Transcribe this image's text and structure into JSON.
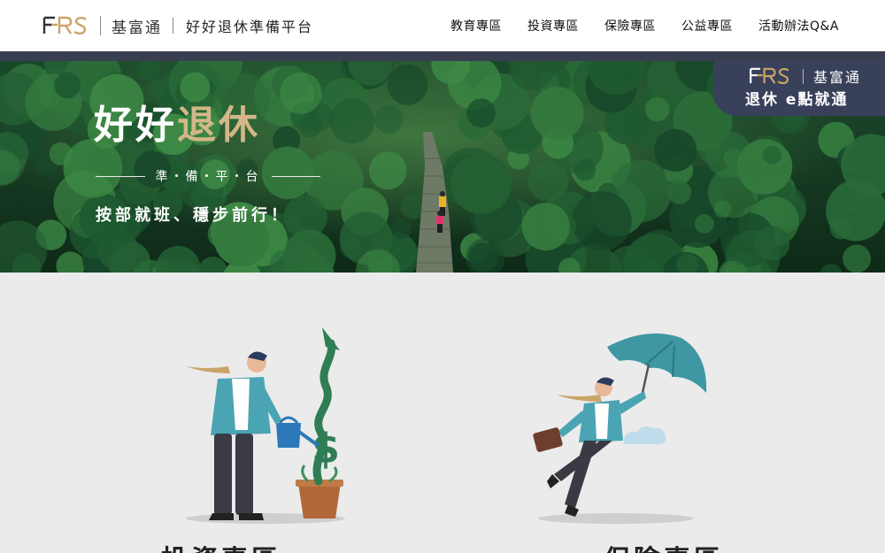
{
  "header": {
    "logo_mark": "FRS",
    "brand_name": "基富通",
    "site_title": "好好退休準備平台",
    "nav": [
      {
        "label": "教育專區"
      },
      {
        "label": "投資專區"
      },
      {
        "label": "保險專區"
      },
      {
        "label": "公益專區"
      },
      {
        "label": "活動辦法Q&A"
      }
    ]
  },
  "hero": {
    "title_white": "好好",
    "title_gold": "退休",
    "subtitle": "準・備・平・台",
    "tagline": "按部就班、穩步前行！",
    "badge": {
      "logo_mark": "FRS",
      "brand_name": "基富通",
      "slogan": "退休 e點就通"
    }
  },
  "zones": [
    {
      "title": "投資專區",
      "illustration": "man-watering-dollar-plant"
    },
    {
      "title": "保險專區",
      "illustration": "man-with-umbrella"
    }
  ],
  "colors": {
    "gold": "#c9a56a",
    "navy": "#393f51",
    "teal": "#4aa4b3",
    "plant_green": "#2f7d54"
  }
}
